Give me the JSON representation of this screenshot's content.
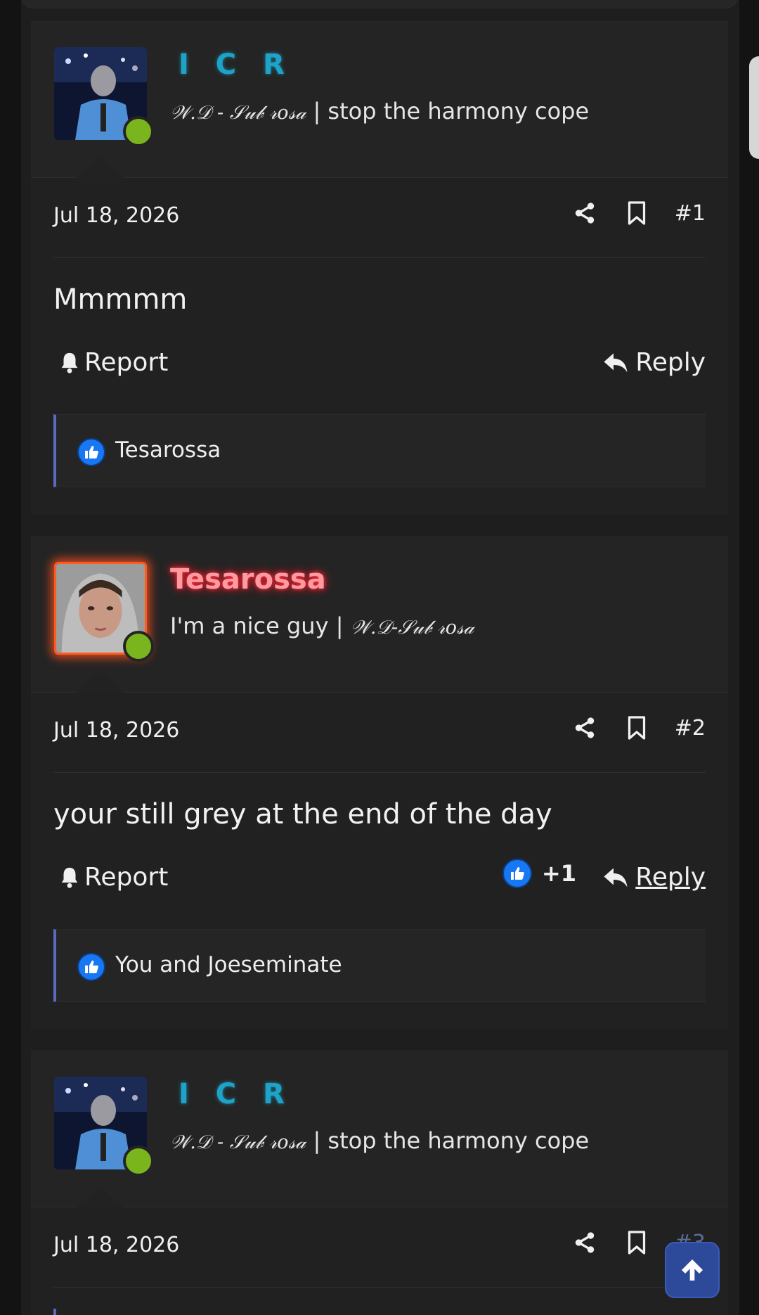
{
  "posts": [
    {
      "username": "I C R",
      "title_script": "𝒲.𝒟 - 𝒮𝓊𝒷 𝓇𝑜𝓈𝒶",
      "title_text": " | stop the harmony cope",
      "date": "Jul 18, 2026",
      "number": "#1",
      "message": "Mmmmm",
      "report_label": "Report",
      "reply_label": "Reply",
      "reactions": "Tesarossa"
    },
    {
      "username": "Tesarossa",
      "title_text": "I'm a nice guy | ",
      "title_script": "𝒲.𝒟-𝒮𝓊𝒷 𝓇𝑜𝓈𝒶",
      "date": "Jul 18, 2026",
      "number": "#2",
      "message": "your still grey at the end of the day",
      "report_label": "Report",
      "reply_label": "Reply",
      "reaction_count": "+1",
      "reactions": "You and Joeseminate"
    },
    {
      "username": "I C R",
      "title_script": "𝒲.𝒟 - 𝒮𝓊𝒷 𝓇𝑜𝓈𝒶",
      "title_text": " | stop the harmony cope",
      "date": "Jul 18, 2026",
      "number": "#3"
    }
  ],
  "icons": {
    "share": "share-icon",
    "bookmark": "bookmark-icon",
    "bell": "bell-icon",
    "reply": "reply-arrow-icon",
    "like": "thumbs-up-icon",
    "scroll_top": "arrow-up-icon"
  },
  "colors": {
    "username_blue": "#1ea3c8",
    "username_red_glow": "#ff2a3a",
    "online": "#7ab51d",
    "like_blue": "#1877f2",
    "reaction_bar_accent": "#5b6ac0",
    "scroll_top_bg": "#2d4a9a"
  }
}
